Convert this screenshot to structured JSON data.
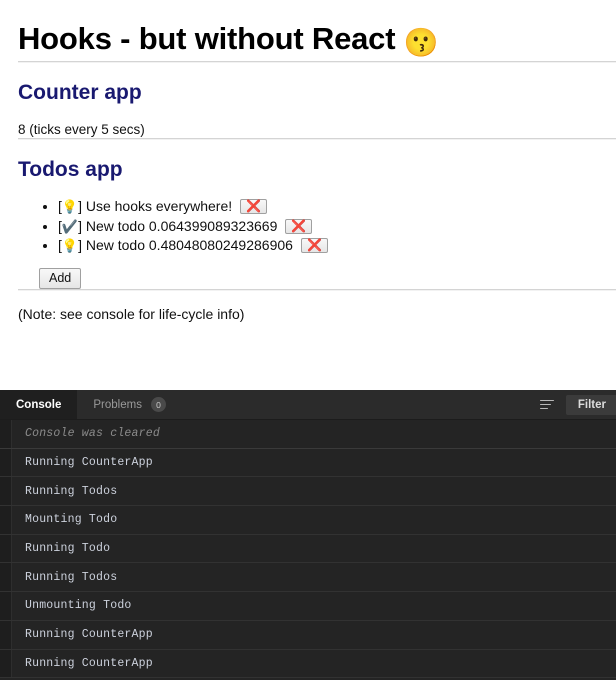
{
  "page": {
    "title_text": "Hooks - but without React ",
    "title_emoji": "😗",
    "counter": {
      "heading": "Counter app",
      "value_line": "8 (ticks every 5 secs)"
    },
    "todos": {
      "heading": "Todos app",
      "items": [
        {
          "open_bracket": "[",
          "mark": "💡",
          "close_bracket": "]",
          "text": " Use hooks everywhere!",
          "delete_label": "❌"
        },
        {
          "open_bracket": "[",
          "mark": "✔️",
          "close_bracket": "]",
          "text": " New todo 0.064399089323669",
          "delete_label": "❌"
        },
        {
          "open_bracket": "[",
          "mark": "💡",
          "close_bracket": "]",
          "text": " New todo 0.48048080249286906",
          "delete_label": "❌"
        }
      ],
      "add_label": "Add"
    },
    "note": "(Note: see console for life-cycle info)"
  },
  "devtools": {
    "tabs": [
      {
        "label": "Console",
        "active": true
      },
      {
        "label": "Problems",
        "active": false,
        "badge": "0"
      }
    ],
    "filter_icon": "filter-lines-icon",
    "filter_label": "Filter",
    "log": [
      {
        "text": "Console was cleared",
        "kind": "cleared"
      },
      {
        "text": "Running CounterApp",
        "kind": "log"
      },
      {
        "text": "Running Todos",
        "kind": "log"
      },
      {
        "text": "Mounting Todo",
        "kind": "log"
      },
      {
        "text": "Running Todo",
        "kind": "log"
      },
      {
        "text": "Running Todos",
        "kind": "log"
      },
      {
        "text": "Unmounting Todo",
        "kind": "log"
      },
      {
        "text": "Running CounterApp",
        "kind": "log"
      },
      {
        "text": "Running CounterApp",
        "kind": "log"
      }
    ]
  },
  "colors": {
    "heading": "#191970",
    "console_bg": "#242424",
    "console_text": "#cdd2dd"
  }
}
